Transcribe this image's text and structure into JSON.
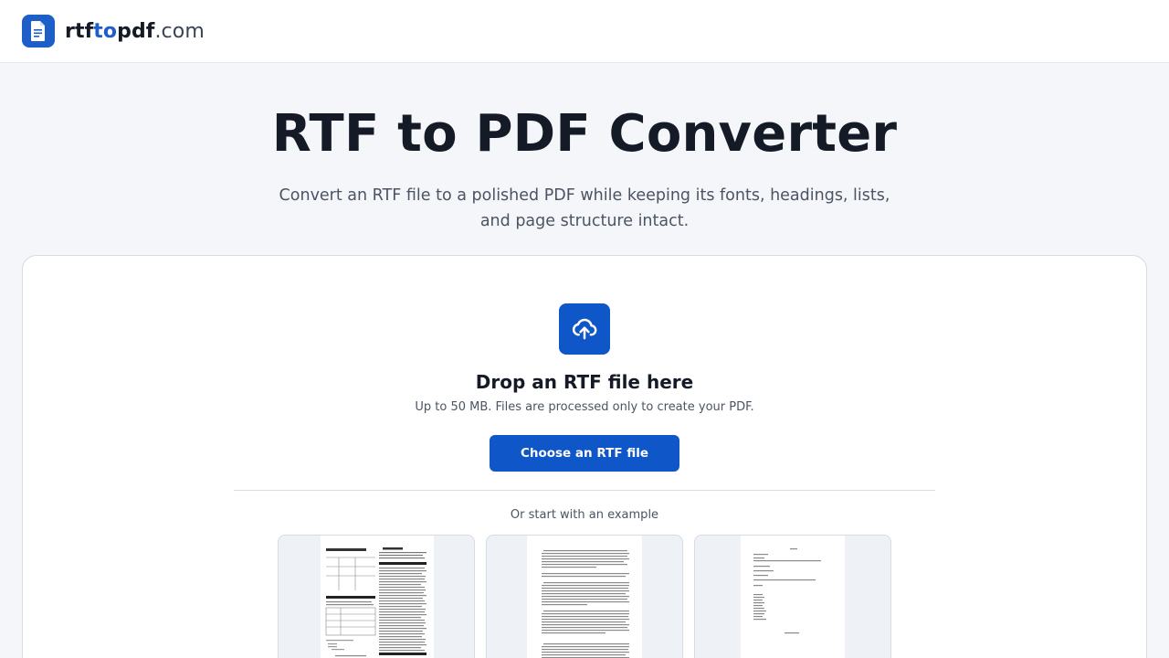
{
  "header": {
    "logo_icon": "document-icon",
    "logo_part1": "rtf",
    "logo_part2": "to",
    "logo_part3": "pdf",
    "logo_part4": ".com"
  },
  "hero": {
    "title": "RTF to PDF Converter",
    "subtitle": "Convert an RTF file to a polished PDF while keeping its fonts, headings, lists, and page structure intact."
  },
  "upload": {
    "icon": "cloud-upload-icon",
    "title": "Drop an RTF file here",
    "note": "Up to 50 MB. Files are processed only to create your PDF.",
    "button_label": "Choose an RTF file"
  },
  "examples": {
    "label": "Or start with an example",
    "items": [
      {
        "kind": "form-document-thumbnail"
      },
      {
        "kind": "text-document-thumbnail"
      },
      {
        "kind": "letter-document-thumbnail"
      }
    ]
  },
  "colors": {
    "brand": "#0f57c8",
    "background": "#f4f6fa",
    "text": "#141a26",
    "muted": "#4b5463",
    "border": "#d6dbe4"
  }
}
